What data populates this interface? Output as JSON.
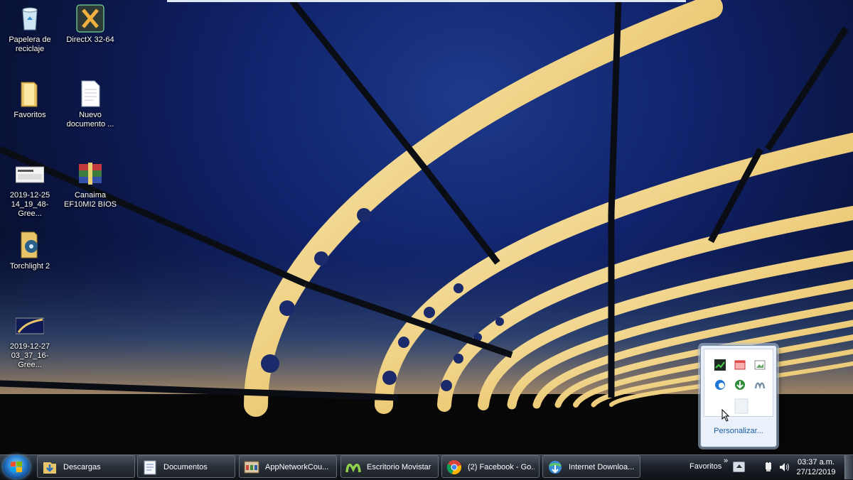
{
  "desktop": {
    "icons": [
      {
        "label": "Papelera de\nreciclaje",
        "icon": "recycle-bin-icon"
      },
      {
        "label": "DirectX 32-64",
        "icon": "directx-icon"
      },
      {
        "label": "Favoritos",
        "icon": "folder-icon"
      },
      {
        "label": "Nuevo\ndocumento ...",
        "icon": "document-icon"
      },
      {
        "label": "2019-12-25\n14_19_48-Gree...",
        "icon": "screenshot-thumbnail-icon"
      },
      {
        "label": "Canaima\nEF10MI2 BIOS",
        "icon": "winrar-archive-icon"
      },
      {
        "label": "Torchlight 2",
        "icon": "game-folder-icon"
      },
      {
        "label": "2019-12-27\n03_37_16-Gree...",
        "icon": "screenshot-thumbnail-icon"
      }
    ]
  },
  "taskbar": {
    "buttons": [
      {
        "label": "Descargas",
        "icon": "downloads-folder-icon"
      },
      {
        "label": "Documentos",
        "icon": "documents-icon"
      },
      {
        "label": "AppNetworkCou...",
        "icon": "app-network-counter-icon"
      },
      {
        "label": "Escritorio Movistar",
        "icon": "movistar-icon"
      },
      {
        "label": "(2) Facebook - Go...",
        "icon": "chrome-icon"
      },
      {
        "label": "Internet Downloa...",
        "icon": "internet-download-manager-icon"
      }
    ],
    "toolbar_label": "Favoritos",
    "toolbar_chevron": "»",
    "clock": {
      "time": "03:37 a.m.",
      "date": "27/12/2019"
    }
  },
  "tray_popup": {
    "customize_label": "Personalizar..."
  },
  "colors": {
    "taskbar": "#1c2129",
    "popup_bg": "#eaf1fa",
    "link": "#1a5ea8"
  }
}
